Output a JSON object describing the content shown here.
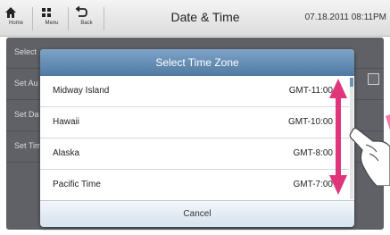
{
  "topbar": {
    "home_label": "Home",
    "menu_label": "Menu",
    "back_label": "Back",
    "title": "Date & Time",
    "datetime": "07.18.2011 08:11PM"
  },
  "background_rows": [
    {
      "label": "Select"
    },
    {
      "label": "Set Au"
    },
    {
      "label": "Set Da"
    },
    {
      "label": "Set Tim"
    }
  ],
  "dialog": {
    "title": "Select Time Zone",
    "cancel_label": "Cancel",
    "items": [
      {
        "name": "Midway Island",
        "offset": "GMT-11:00"
      },
      {
        "name": "Hawaii",
        "offset": "GMT-10:00"
      },
      {
        "name": "Alaska",
        "offset": "GMT-8:00"
      },
      {
        "name": "Pacific Time",
        "offset": "GMT-7:00"
      }
    ]
  },
  "colors": {
    "arrow": "#e0357a",
    "dialog_header": "#5f86ae",
    "background_dim": "#5f6166"
  },
  "icons": {
    "home": "home-icon",
    "menu": "menu-grid-icon",
    "back": "back-arrow-icon",
    "gesture": "swipe-hand-icon",
    "scroll_hint": "double-arrow-icon"
  }
}
